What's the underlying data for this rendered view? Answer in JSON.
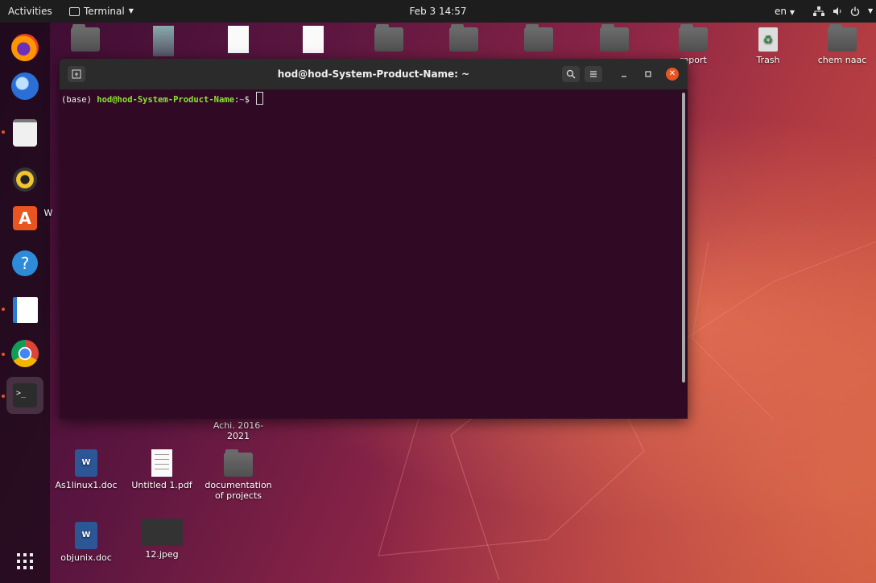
{
  "topbar": {
    "activities": "Activities",
    "app_name": "Terminal",
    "clock": "Feb 3  14:57",
    "input_source": "en"
  },
  "dock": {
    "items": [
      {
        "name": "firefox",
        "running": false
      },
      {
        "name": "thunderbird",
        "running": false
      },
      {
        "name": "files",
        "running": true
      },
      {
        "name": "rhythmbox",
        "running": false
      },
      {
        "name": "ubuntu-software",
        "running": false
      },
      {
        "name": "help",
        "running": false
      },
      {
        "name": "libreoffice-impress",
        "running": true
      },
      {
        "name": "chrome",
        "running": true
      },
      {
        "name": "terminal",
        "running": true
      }
    ]
  },
  "desktop": {
    "top_row": [
      "report",
      "Trash",
      "chem naac"
    ],
    "bottom_icons": [
      {
        "label": "Achi. 2016-2021"
      },
      {
        "label": "As1linux1.doc"
      },
      {
        "label": "Untitled 1.pdf"
      },
      {
        "label": "documentation of projects"
      },
      {
        "label": "objunix.doc"
      },
      {
        "label": "12.jpeg"
      }
    ],
    "cut_labels": [
      "W"
    ]
  },
  "terminal": {
    "title": "hod@hod-System-Product-Name: ~",
    "prompt_env": "(base) ",
    "prompt_user": "hod@hod-System-Product-Name",
    "prompt_sep": ":",
    "prompt_path": "~",
    "prompt_symbol": "$ "
  },
  "colors": {
    "accent": "#e95420",
    "terminal_bg": "#300a24",
    "prompt_user": "#8ae234",
    "prompt_path": "#729fcf"
  }
}
